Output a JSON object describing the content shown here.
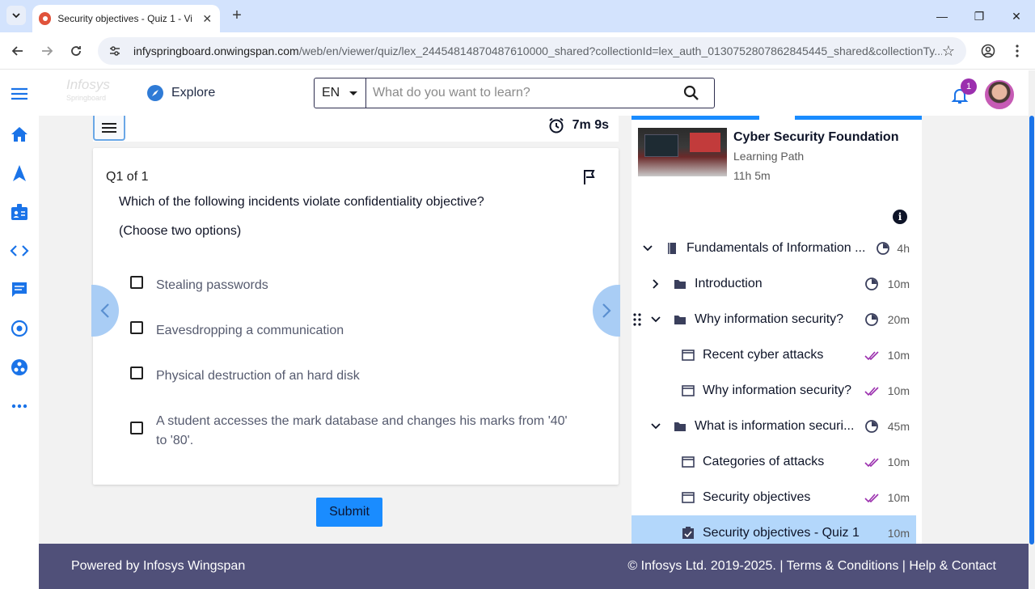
{
  "browser": {
    "tab_title": "Security objectives - Quiz 1 - Vi",
    "url_host": "infyspringboard.onwingspan.com",
    "url_path": "/web/en/viewer/quiz/lex_24454814870487610000_shared?collectionId=lex_auth_013075280786284544​5_shared&collectionTy..."
  },
  "header": {
    "logo_text": "Infosys",
    "logo_sub": "Springboard",
    "explore_label": "Explore",
    "language": "EN",
    "search_placeholder": "What do you want to learn?",
    "notification_count": "1"
  },
  "quiz": {
    "timer": "7m 9s",
    "question_counter": "Q1 of 1",
    "question": "Which of the following incidents violate confidentiality objective?",
    "instruction": "(Choose two options)",
    "options": [
      "Stealing passwords",
      "Eavesdropping a communication",
      "Physical destruction of an hard disk",
      "A student accesses the mark database and changes his marks from '40' to '80'."
    ],
    "submit_label": "Submit"
  },
  "course": {
    "title": "Cyber Security Foundation",
    "type": "Learning Path",
    "duration": "11h 5m",
    "info_glyph": "i",
    "toc": [
      {
        "label": "Fundamentals of Information ...",
        "duration": "4h",
        "kind": "module",
        "status": "in-progress"
      },
      {
        "label": "Introduction",
        "duration": "10m",
        "kind": "folder",
        "status": "in-progress"
      },
      {
        "label": "Why information security?",
        "duration": "20m",
        "kind": "folder",
        "status": "in-progress"
      },
      {
        "label": "Recent cyber attacks",
        "duration": "10m",
        "kind": "resource",
        "status": "done"
      },
      {
        "label": "Why information security?",
        "duration": "10m",
        "kind": "resource",
        "status": "done"
      },
      {
        "label": "What is information securi...",
        "duration": "45m",
        "kind": "folder",
        "status": "in-progress"
      },
      {
        "label": "Categories of attacks",
        "duration": "10m",
        "kind": "resource",
        "status": "done"
      },
      {
        "label": "Security objectives",
        "duration": "10m",
        "kind": "resource",
        "status": "done"
      },
      {
        "label": "Security objectives - Quiz 1",
        "duration": "10m",
        "kind": "quiz",
        "status": "active"
      }
    ]
  },
  "footer": {
    "left": "Powered by Infosys Wingspan",
    "right": "© Infosys Ltd. 2019-2025. | Terms & Conditions | Help & Contact"
  },
  "colors": {
    "accent": "#1a8cff",
    "footer_bg": "#505079",
    "rail_icons": "#1a73e8",
    "done_check": "#9b2fae"
  }
}
